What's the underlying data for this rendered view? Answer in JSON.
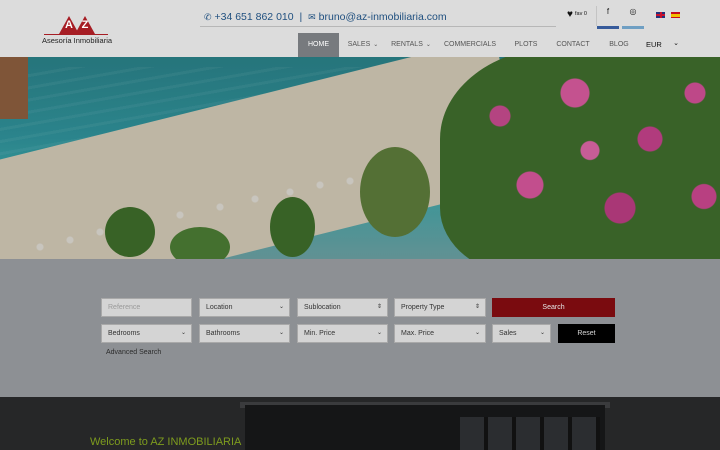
{
  "header": {
    "logo_letters": "AZ",
    "logo_text": "Asesoría Inmobiliaria",
    "phone": "+34 651 862 010",
    "email": "bruno@az-inmobiliaria.com",
    "fav_label": "fav 0",
    "social": {
      "facebook_glyph": "f",
      "instagram_glyph": "◎"
    },
    "currency": "EUR"
  },
  "icons": {
    "phone": "phone-icon",
    "email": "envelope-icon",
    "fav": "heart-icon",
    "facebook": "facebook-icon",
    "instagram": "instagram-icon",
    "flag_en": "uk-flag-icon",
    "flag_es": "spain-flag-icon"
  },
  "nav": {
    "items": [
      {
        "label": "HOME",
        "has_dropdown": false,
        "active": true
      },
      {
        "label": "SALES",
        "has_dropdown": true,
        "active": false
      },
      {
        "label": "RENTALS",
        "has_dropdown": true,
        "active": false
      },
      {
        "label": "COMMERCIALS",
        "has_dropdown": false,
        "active": false
      },
      {
        "label": "PLOTS",
        "has_dropdown": false,
        "active": false
      },
      {
        "label": "CONTACT",
        "has_dropdown": false,
        "active": false
      },
      {
        "label": "BLOG",
        "has_dropdown": false,
        "active": false
      }
    ]
  },
  "search": {
    "reference_placeholder": "Reference",
    "location": "Location",
    "sublocation": "Sublocation",
    "property_type": "Property Type",
    "search_button": "Search",
    "bedrooms": "Bedrooms",
    "bathrooms": "Bathrooms",
    "min_price": "Min. Price",
    "max_price": "Max. Price",
    "mode": "Sales",
    "reset_button": "Reset",
    "advanced_link": "Advanced Search"
  },
  "welcome": {
    "title": "Welcome to AZ INMOBILIARIA"
  },
  "colors": {
    "brand_red": "#a61d24",
    "search_button": "#7a0b0f",
    "reset_button": "#000000",
    "welcome_title": "#7e9c1e",
    "facebook_bar": "#375b9b",
    "instagram_bar": "#6f9fc3"
  }
}
